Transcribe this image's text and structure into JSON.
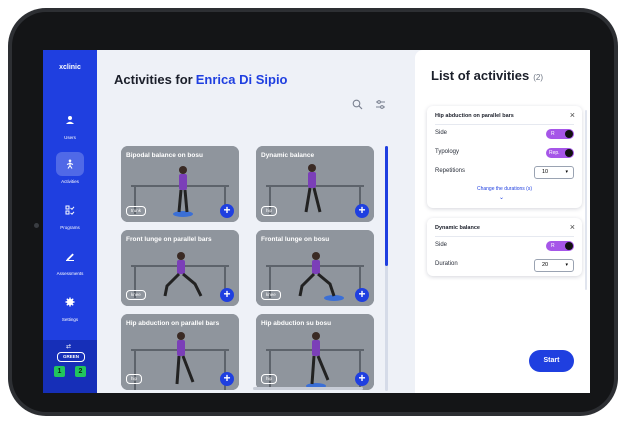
{
  "app": {
    "brand": "xclinic"
  },
  "sidebar": {
    "items": [
      {
        "label": "Users",
        "icon": "user-icon"
      },
      {
        "label": "Activities",
        "icon": "activities-icon",
        "active": true
      },
      {
        "label": "Programs",
        "icon": "programs-icon"
      },
      {
        "label": "Assessments",
        "icon": "assessments-icon"
      },
      {
        "label": "Settings",
        "icon": "gear-icon"
      }
    ],
    "footer": {
      "status": "GREEN",
      "left_count": "1",
      "right_count": "2"
    }
  },
  "main": {
    "title_prefix": "Activities for",
    "patient_name": "Enrica Di Sipio",
    "cards": [
      {
        "title": "Bipodal balance on bosu",
        "tag": "trunk"
      },
      {
        "title": "Dynamic balance",
        "tag": "hip"
      },
      {
        "title": "Front lunge on parallel bars",
        "tag": "knee"
      },
      {
        "title": "Frontal lunge on bosu",
        "tag": "knee"
      },
      {
        "title": "Hip abduction on parallel bars",
        "tag": "hip"
      },
      {
        "title": "Hip abduction su bosu",
        "tag": "hip"
      }
    ]
  },
  "panel": {
    "title": "List of activities",
    "count": "(2)",
    "start_label": "Start",
    "activities": [
      {
        "title": "Hip abduction on parallel bars",
        "side_label": "Side",
        "side_value": "R",
        "typology_label": "Typology",
        "typology_value": "Rep.",
        "repetitions_label": "Repetitions",
        "repetitions_value": "10",
        "link": "Change the durations (s)"
      },
      {
        "title": "Dynamic balance",
        "side_label": "Side",
        "side_value": "R",
        "duration_label": "Duration",
        "duration_value": "20"
      }
    ]
  },
  "colors": {
    "accent": "#1f3fe0",
    "toggle": "#a656e8",
    "badge": "#22c55e"
  }
}
